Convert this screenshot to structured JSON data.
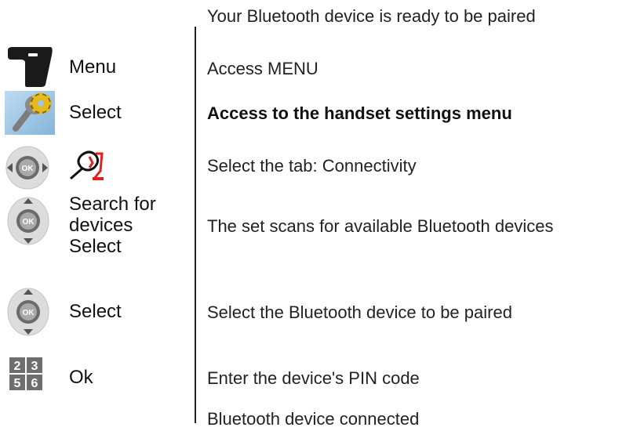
{
  "steps": [
    {
      "key_label": "",
      "description": "Your Bluetooth device is ready to be paired",
      "icon": "none"
    },
    {
      "key_label": "Menu",
      "description": "Access MENU",
      "icon": "softkey-icon"
    },
    {
      "key_label": "Select",
      "description": "Access to the handset settings menu",
      "icon": "settings-tools-icon"
    },
    {
      "key_label": "",
      "description": "Select the tab: Connectivity",
      "icon": "nav-left-right-icon + connectivity-tab-icon"
    },
    {
      "key_label_lines": [
        "Search for",
        "devices",
        "Select"
      ],
      "description": "The set scans for available Bluetooth devices",
      "icon": "nav-up-down-icon"
    },
    {
      "key_label": "Select",
      "description": "Select the Bluetooth device to be paired",
      "icon": "nav-up-down-icon"
    },
    {
      "key_label": "Ok",
      "description": "Enter the device's PIN code",
      "icon": "keypad-icon"
    },
    {
      "key_label": "",
      "description": "Bluetooth device connected",
      "icon": "none"
    }
  ],
  "keypad_digits": [
    "2",
    "3",
    "5",
    "6"
  ],
  "colors": {
    "text": "#1a1a1a",
    "settings_bg": "#9cc7e6",
    "nav_gray": "#d2d2d2",
    "nav_dark": "#6a6a6a",
    "keypad_gray": "#6e6e6e"
  }
}
